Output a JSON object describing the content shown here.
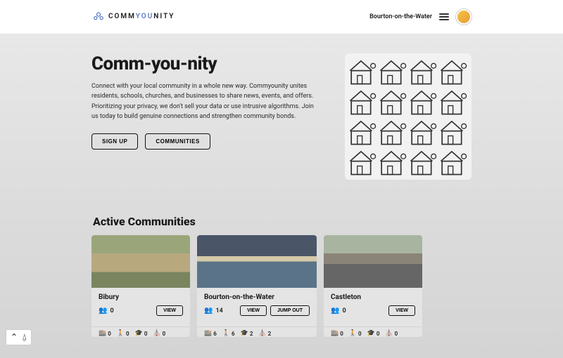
{
  "header": {
    "logo_pre": "COMM",
    "logo_mid": "YOU",
    "logo_post": "NITY",
    "location": "Bourton-on-the-Water"
  },
  "hero": {
    "title": "Comm-you-nity",
    "description": "Connect with your local community in a whole new way. Commyounity unites residents, schools, churches, and businesses to share news, events, and offers. Prioritizing your privacy, we don't sell your data or use intrusive algorithms. Join us today to build genuine connections and strengthen community bonds.",
    "signup_label": "SIGN UP",
    "communities_label": "COMMUNITIES"
  },
  "section": {
    "title": "Active Communities"
  },
  "communities": [
    {
      "name": "Bibury",
      "members": "0",
      "view_label": "VIEW",
      "stats": {
        "shop": "0",
        "walk": "0",
        "school": "0",
        "church": "0"
      }
    },
    {
      "name": "Bourton-on-the-Water",
      "members": "14",
      "view_label": "VIEW",
      "jump_label": "JUMP OUT",
      "stats": {
        "shop": "6",
        "walk": "6",
        "school": "2",
        "church": "2"
      }
    },
    {
      "name": "Castleton",
      "members": "0",
      "view_label": "VIEW",
      "stats": {
        "shop": "0",
        "walk": "0",
        "school": "0",
        "church": "0"
      }
    }
  ]
}
